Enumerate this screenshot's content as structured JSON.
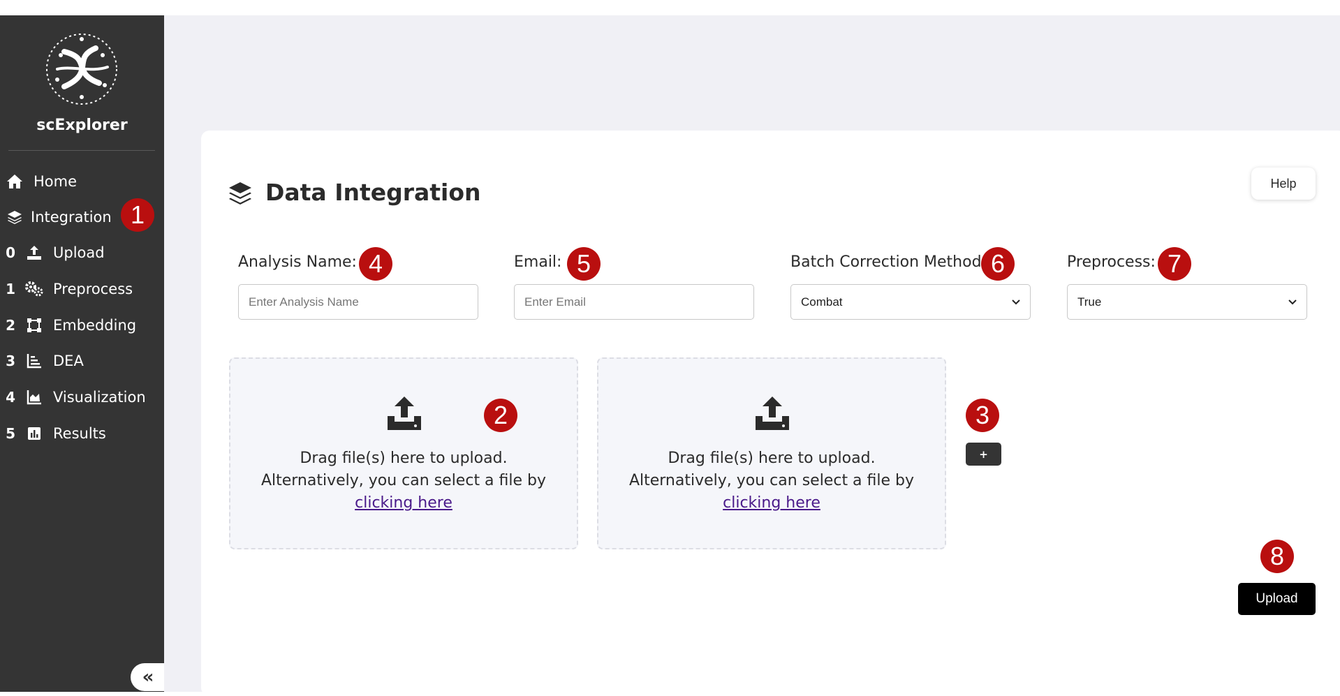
{
  "app": {
    "brand": "scExplorer",
    "logo_icon": "dna-network-logo"
  },
  "sidebar": {
    "items": [
      {
        "num": "",
        "icon": "home-icon",
        "label": "Home"
      },
      {
        "num": "",
        "icon": "layers-icon",
        "label": "Integration"
      },
      {
        "num": "0",
        "icon": "upload-icon",
        "label": "Upload"
      },
      {
        "num": "1",
        "icon": "gears-icon",
        "label": "Preprocess"
      },
      {
        "num": "2",
        "icon": "vector-square-icon",
        "label": "Embedding"
      },
      {
        "num": "3",
        "icon": "bar-chart-icon",
        "label": "DEA"
      },
      {
        "num": "4",
        "icon": "area-chart-icon",
        "label": "Visualization"
      },
      {
        "num": "5",
        "icon": "poll-icon",
        "label": "Results"
      }
    ],
    "collapse_label": "«"
  },
  "page": {
    "title": "Data Integration",
    "title_icon": "layers-icon",
    "help_label": "Help"
  },
  "form": {
    "analysis_name": {
      "label": "Analysis Name:",
      "placeholder": "Enter Analysis Name"
    },
    "email": {
      "label": "Email:",
      "placeholder": "Enter Email"
    },
    "batch_correction": {
      "label": "Batch Correction Method:",
      "value": "Combat"
    },
    "preprocess": {
      "label": "Preprocess:",
      "value": "True"
    }
  },
  "dropzones": [
    {
      "line1": "Drag file(s) here to upload.",
      "line2": "Alternatively, you can select a file by",
      "link": "clicking here"
    },
    {
      "line1": "Drag file(s) here to upload.",
      "line2": "Alternatively, you can select a file by",
      "link": "clicking here"
    }
  ],
  "add_button_label": "+",
  "upload_button_label": "Upload",
  "markers": [
    "1",
    "2",
    "3",
    "4",
    "5",
    "6",
    "7",
    "8"
  ],
  "colors": {
    "sidebar": "#343434",
    "marker": "#b90f0f",
    "link": "#4a1a8a",
    "background": "#f0f0f5"
  }
}
